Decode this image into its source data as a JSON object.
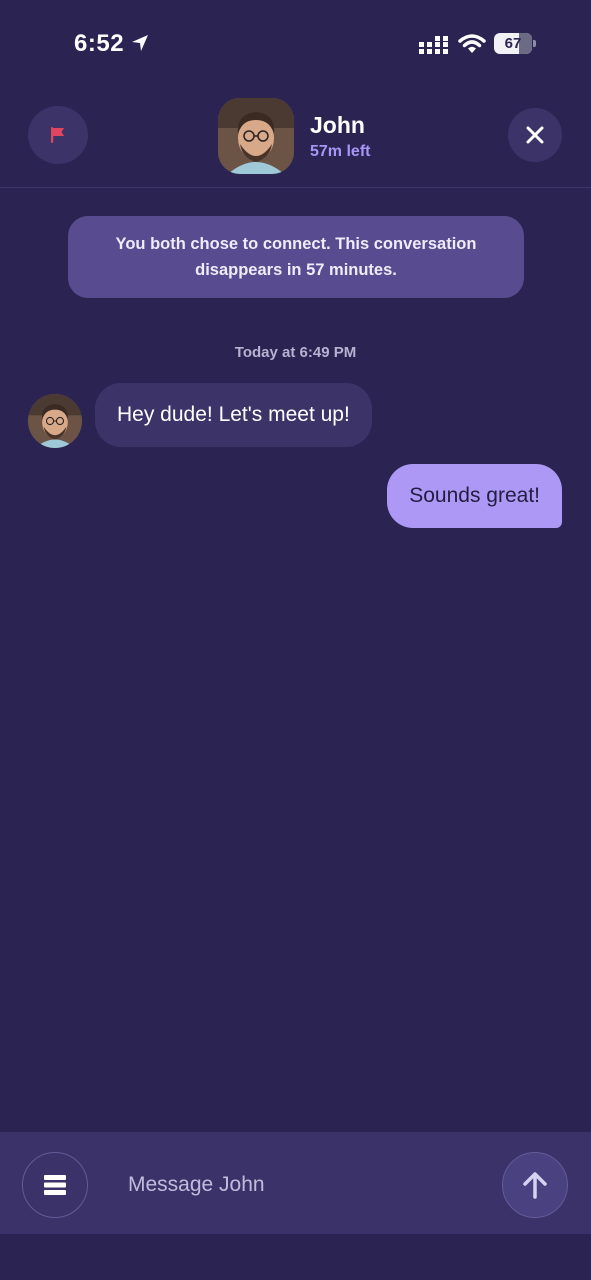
{
  "status_bar": {
    "time": "6:52",
    "battery": "67",
    "icons": [
      "location-arrow-icon",
      "signal-icon",
      "wifi-icon",
      "battery-icon"
    ]
  },
  "header": {
    "name": "John",
    "time_left": "57m left",
    "report_icon": "flag-icon",
    "close_icon": "close-icon"
  },
  "notice": {
    "text": "You both chose to connect. This conversation disappears in 57 minutes."
  },
  "chat": {
    "timestamp": "Today at 6:49 PM",
    "messages": [
      {
        "direction": "incoming",
        "text": "Hey dude! Let's meet up!"
      },
      {
        "direction": "outgoing",
        "text": "Sounds great!"
      }
    ]
  },
  "composer": {
    "placeholder": "Message John",
    "menu_icon": "menu-icon",
    "send_icon": "send-arrow-icon"
  },
  "colors": {
    "background": "#2b2453",
    "accent": "#ad98f5",
    "flag": "#e0475f"
  }
}
